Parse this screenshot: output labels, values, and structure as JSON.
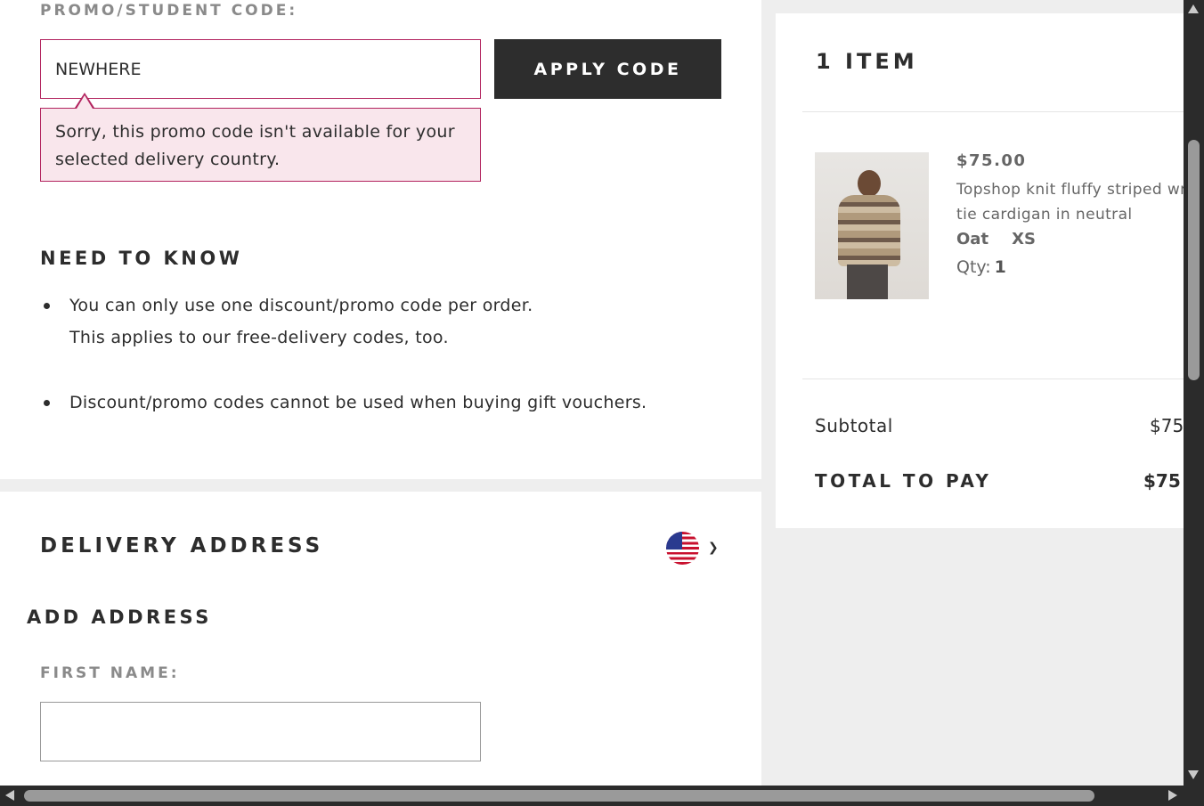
{
  "promo": {
    "label": "PROMO/STUDENT CODE:",
    "input_value": "NEWHERE",
    "apply_label": "APPLY CODE",
    "error_line1": "Sorry, this promo code isn't available for your",
    "error_line2": "selected delivery country."
  },
  "need_to_know": {
    "title": "NEED TO KNOW",
    "items": [
      {
        "line1": "You can only use one discount/promo code per order.",
        "line2": "This applies to our free-delivery codes, too."
      },
      {
        "line1": "Discount/promo codes cannot be used when buying gift vouchers."
      }
    ]
  },
  "delivery": {
    "title": "DELIVERY ADDRESS",
    "country_flag_icon": "us-flag-icon",
    "add_address_title": "ADD ADDRESS",
    "first_name_label": "FIRST NAME:",
    "first_name_value": ""
  },
  "cart": {
    "items_title": "1 ITEM",
    "item": {
      "price": "$75.00",
      "name_line1": "Topshop knit fluffy striped wr",
      "name_line2": "tie cardigan in neutral",
      "color": "Oat",
      "size": "XS",
      "qty_label": "Qty:",
      "qty_value": "1"
    },
    "subtotal_label": "Subtotal",
    "subtotal_value": "$75",
    "total_label": "TOTAL TO PAY",
    "total_value": "$75"
  },
  "colors": {
    "error_border": "#b2245f",
    "error_bg": "#f9e6ec",
    "button_bg": "#2d2d2d"
  }
}
